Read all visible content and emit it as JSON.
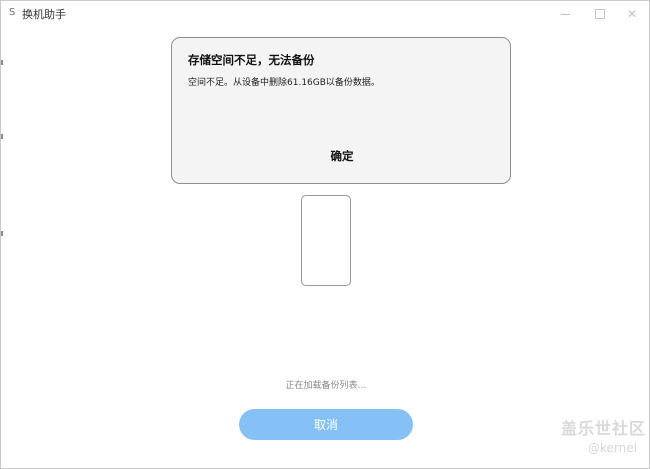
{
  "app": {
    "logo": "S",
    "title": "换机助手"
  },
  "dialog": {
    "title": "存储空间不足，无法备份",
    "message": "空间不足。从设备中删除61.16GB以备份数据。",
    "ok_label": "确定"
  },
  "status": {
    "loading_text": "正在加载备份列表…"
  },
  "actions": {
    "cancel_label": "取消"
  },
  "watermark": {
    "brand": "盖乐世社区",
    "user": "@kernel"
  },
  "colors": {
    "cancel_button_bg": "#85c1f7",
    "dialog_bg": "#f4f4f4"
  },
  "icons": {
    "minimize": "minimize-icon",
    "maximize": "maximize-icon",
    "close": "close-icon",
    "device": "phone-outline"
  }
}
